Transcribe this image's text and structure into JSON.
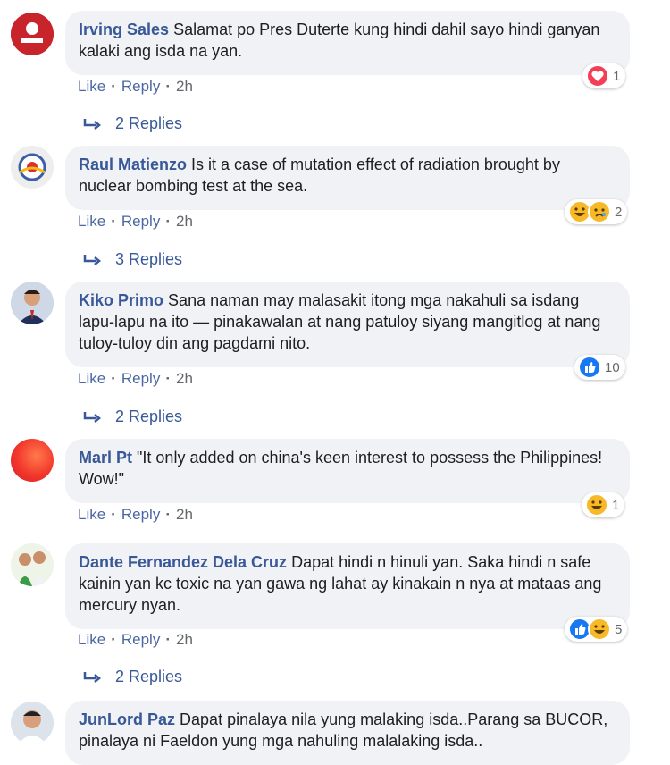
{
  "comments": [
    {
      "author": "Irving Sales",
      "text": "Salamat po Pres Duterte kung hindi dahil sayo hindi ganyan kalaki ang isda na yan.",
      "like": "Like",
      "reply": "Reply",
      "time": "2h",
      "reaction_count": "1",
      "reactions": [
        "heart"
      ],
      "replies": "2 Replies"
    },
    {
      "author": "Raul Matienzo",
      "text": "Is it a case of mutation effect of radiation brought by nuclear bombing test at the sea.",
      "like": "Like",
      "reply": "Reply",
      "time": "2h",
      "reaction_count": "2",
      "reactions": [
        "haha",
        "sad"
      ],
      "replies": "3 Replies"
    },
    {
      "author": "Kiko Primo",
      "text": "Sana naman may malasakit itong mga nakahuli sa isdang lapu-lapu na ito — pinakawalan at nang patuloy siyang mangitlog at nang tuloy-tuloy din ang pagdami nito.",
      "like": "Like",
      "reply": "Reply",
      "time": "2h",
      "reaction_count": "10",
      "reactions": [
        "like"
      ],
      "replies": "2 Replies"
    },
    {
      "author": "Marl Pt",
      "text": "\"It only added on china's keen interest to possess the Philippines! Wow!\"",
      "like": "Like",
      "reply": "Reply",
      "time": "2h",
      "reaction_count": "1",
      "reactions": [
        "haha"
      ]
    },
    {
      "author": "Dante Fernandez Dela Cruz",
      "text": "Dapat hindi n hinuli yan. Saka hindi n safe kainin yan kc toxic na yan gawa ng lahat ay kinakain n nya at mataas ang mercury nyan.",
      "like": "Like",
      "reply": "Reply",
      "time": "2h",
      "reaction_count": "5",
      "reactions": [
        "like",
        "haha"
      ],
      "replies": "2 Replies"
    },
    {
      "author": "JunLord Paz",
      "text": "Dapat pinalaya nila yung malaking isda..Parang sa BUCOR, pinalaya ni Faeldon yung mga nahuling malalaking isda.."
    }
  ],
  "colors": {
    "author": "#385898",
    "bubble": "#f0f2f5",
    "link": "#4b67a1",
    "meta": "#65676b"
  }
}
